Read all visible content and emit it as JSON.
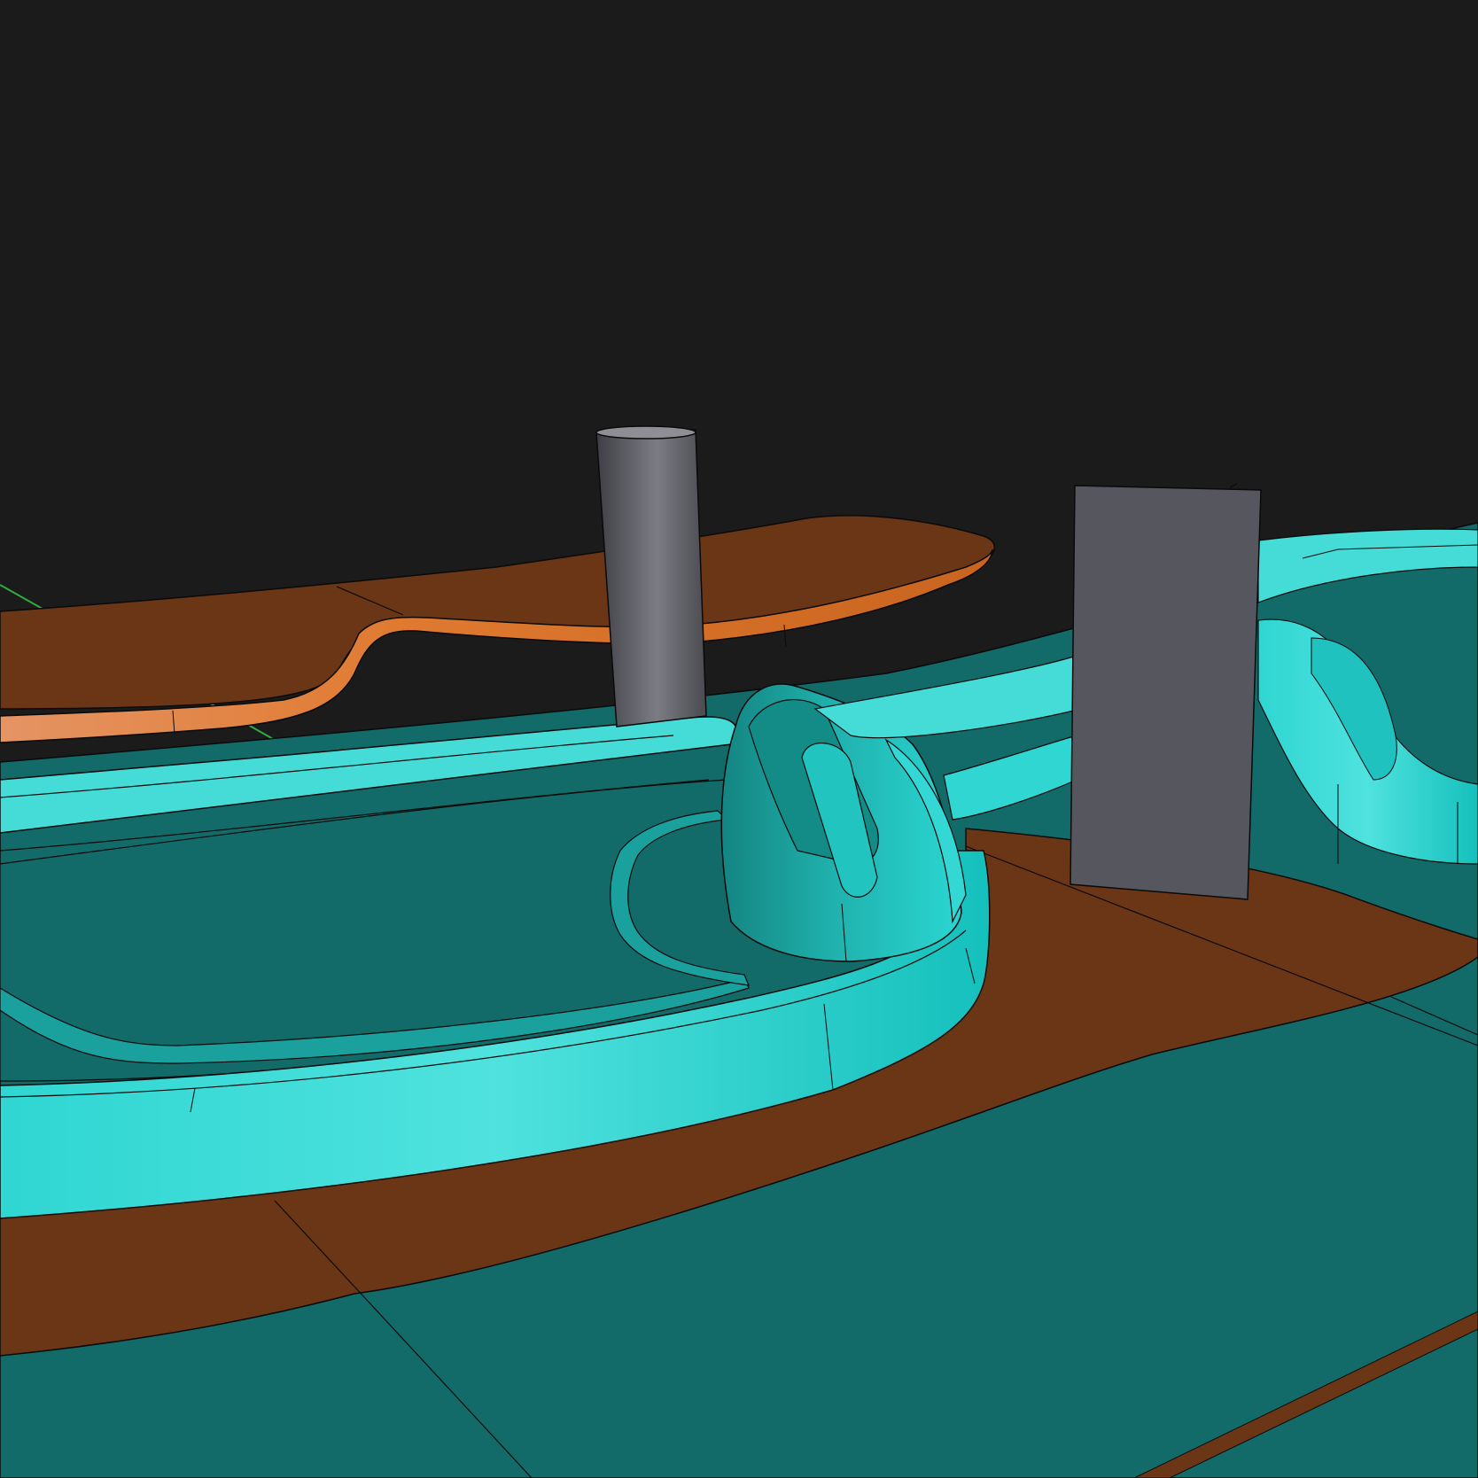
{
  "viewport": {
    "background": "#1b1b1b",
    "colors": {
      "teal_dark": "#136b69",
      "teal_mid": "#1a8f8c",
      "cyan_bright": "#3fe0dc",
      "cyan_light": "#6eeeea",
      "brown": "#6b3616",
      "orange": "#d9742f",
      "orange_light": "#f0a060",
      "gray_block": "#56565e",
      "gray_cylinder": "#6d6d73",
      "axis_green": "#2fae3f",
      "edge": "#0a0a0a"
    },
    "objects": [
      "floating-orange-plate",
      "gray-cylinder",
      "gray-rectangular-block",
      "teal-base-plate",
      "cyan-raised-rim",
      "cyan-mound-feature",
      "brown-underlayer"
    ]
  }
}
